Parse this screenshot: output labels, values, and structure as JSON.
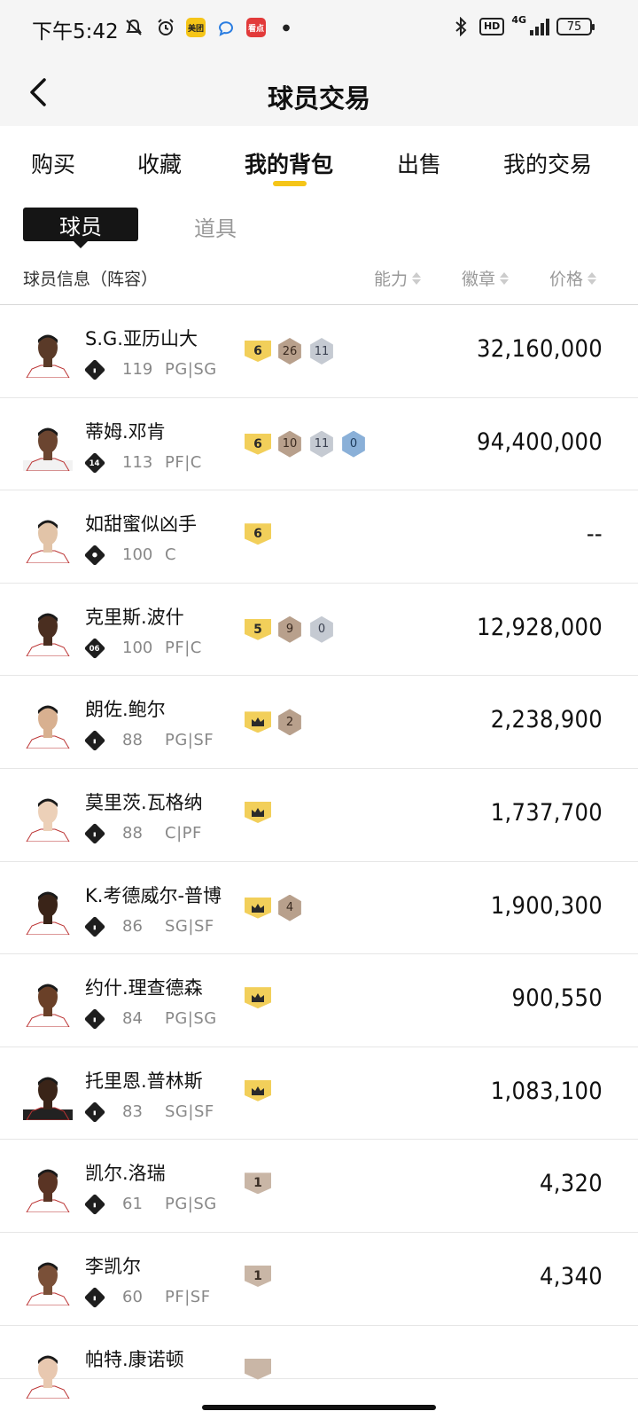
{
  "status_bar": {
    "time": "下午5:42",
    "app_badge_1": "美团",
    "app_badge_2": "看点",
    "network": "4G",
    "hd": "HD",
    "battery": "75"
  },
  "header": {
    "title": "球员交易"
  },
  "tabs": [
    {
      "label": "购买",
      "active": false
    },
    {
      "label": "收藏",
      "active": false
    },
    {
      "label": "我的背包",
      "active": true
    },
    {
      "label": "出售",
      "active": false
    },
    {
      "label": "我的交易",
      "active": false
    }
  ],
  "subtabs": {
    "active": "球员",
    "inactive": "道具"
  },
  "columns": {
    "info": "球员信息（阵容）",
    "ability": "能力",
    "badges": "徽章",
    "price": "价格"
  },
  "players": [
    {
      "name": "S.G.亚历山大",
      "ovr": "119",
      "pos": "PG|SG",
      "jersey": "",
      "badges": [
        {
          "type": "shield-gold",
          "label": "6"
        },
        {
          "type": "hex-bronze",
          "label": "26"
        },
        {
          "type": "hex-silver",
          "label": "11"
        }
      ],
      "price": "32,160,000"
    },
    {
      "name": "蒂姆.邓肯",
      "ovr": "113",
      "pos": "PF|C",
      "jersey": "14",
      "badges": [
        {
          "type": "shield-gold",
          "label": "6"
        },
        {
          "type": "hex-bronze",
          "label": "10"
        },
        {
          "type": "hex-silver",
          "label": "11"
        },
        {
          "type": "hex-blue",
          "label": "0"
        }
      ],
      "price": "94,400,000"
    },
    {
      "name": "如甜蜜似凶手",
      "ovr": "100",
      "pos": "C",
      "jersey": "person",
      "badges": [
        {
          "type": "shield-gold",
          "label": "6"
        }
      ],
      "price": "--"
    },
    {
      "name": "克里斯.波什",
      "ovr": "100",
      "pos": "PF|C",
      "jersey": "06",
      "badges": [
        {
          "type": "shield-gold",
          "label": "5"
        },
        {
          "type": "hex-bronze",
          "label": "9"
        },
        {
          "type": "hex-silver",
          "label": "0"
        }
      ],
      "price": "12,928,000"
    },
    {
      "name": "朗佐.鲍尔",
      "ovr": "88",
      "pos": "PG|SF",
      "jersey": "",
      "badges": [
        {
          "type": "shield-gold",
          "label": "crown"
        },
        {
          "type": "hex-bronze",
          "label": "2"
        }
      ],
      "price": "2,238,900"
    },
    {
      "name": "莫里茨.瓦格纳",
      "ovr": "88",
      "pos": "C|PF",
      "jersey": "",
      "badges": [
        {
          "type": "shield-gold",
          "label": "crown"
        }
      ],
      "price": "1,737,700"
    },
    {
      "name": "K.考德威尔-普博",
      "ovr": "86",
      "pos": "SG|SF",
      "jersey": "",
      "badges": [
        {
          "type": "shield-gold",
          "label": "crown"
        },
        {
          "type": "hex-bronze",
          "label": "4"
        }
      ],
      "price": "1,900,300"
    },
    {
      "name": "约什.理查德森",
      "ovr": "84",
      "pos": "PG|SG",
      "jersey": "",
      "badges": [
        {
          "type": "shield-gold",
          "label": "crown"
        }
      ],
      "price": "900,550"
    },
    {
      "name": "托里恩.普林斯",
      "ovr": "83",
      "pos": "SG|SF",
      "jersey": "",
      "badges": [
        {
          "type": "shield-gold",
          "label": "crown"
        }
      ],
      "price": "1,083,100"
    },
    {
      "name": "凯尔.洛瑞",
      "ovr": "61",
      "pos": "PG|SG",
      "jersey": "",
      "badges": [
        {
          "type": "shield-bronze",
          "label": "1"
        }
      ],
      "price": "4,320"
    },
    {
      "name": "李凯尔",
      "ovr": "60",
      "pos": "PF|SF",
      "jersey": "",
      "badges": [
        {
          "type": "shield-bronze",
          "label": "1"
        }
      ],
      "price": "4,340"
    },
    {
      "name": "帕特.康诺顿",
      "ovr": "",
      "pos": "",
      "jersey": "",
      "badges": [
        {
          "type": "shield-bronze",
          "label": ""
        }
      ],
      "price": ""
    }
  ],
  "colors": {
    "accent": "#f5c518",
    "gold": "#f2cf5a",
    "bronze": "#c9b6a6",
    "dark": "#151515"
  }
}
